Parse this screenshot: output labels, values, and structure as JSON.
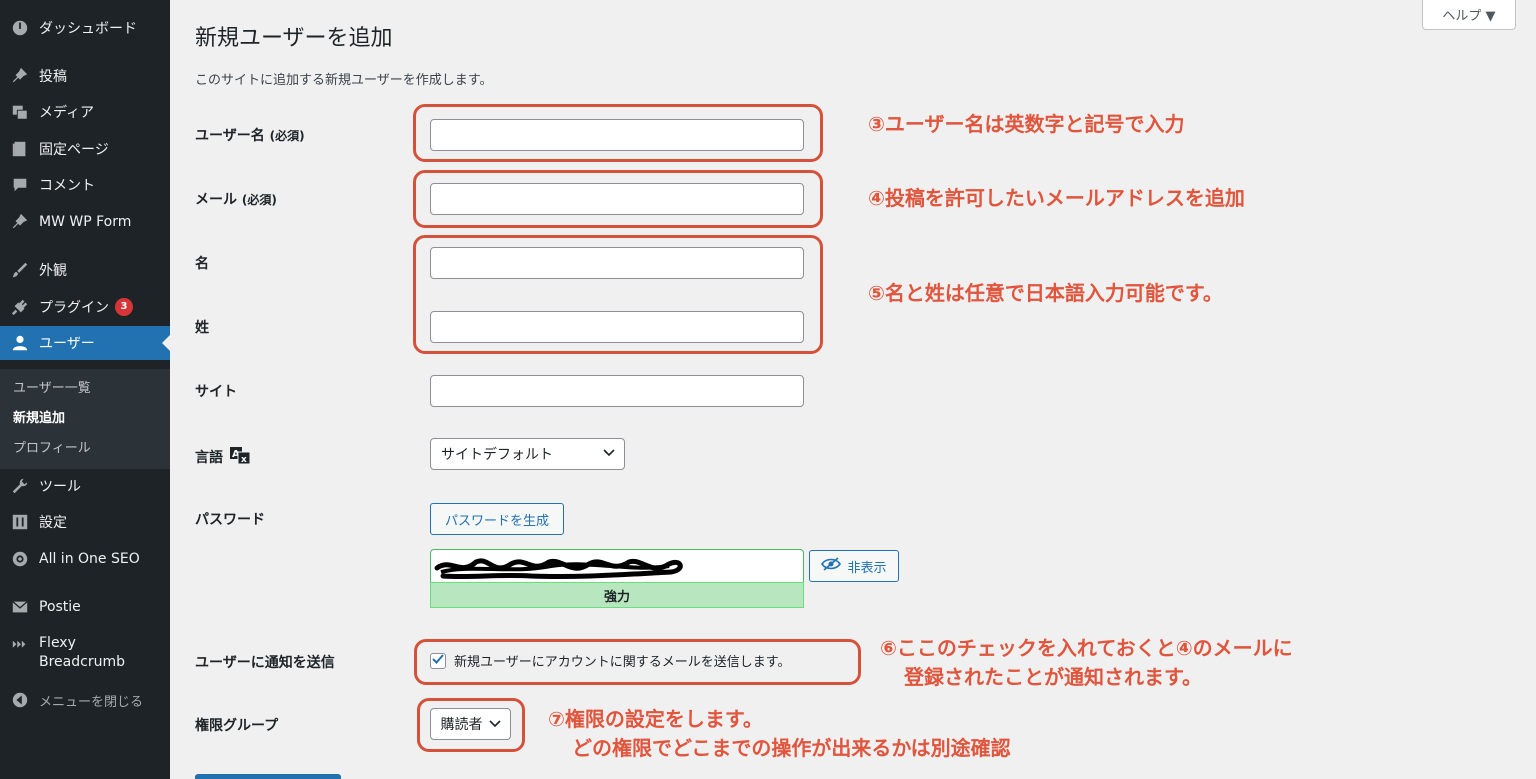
{
  "sidebar": {
    "items": [
      {
        "label": "ダッシュボード",
        "icon": "dashboard-icon"
      },
      {
        "label": "投稿",
        "icon": "pin-icon"
      },
      {
        "label": "メディア",
        "icon": "media-icon"
      },
      {
        "label": "固定ページ",
        "icon": "page-icon"
      },
      {
        "label": "コメント",
        "icon": "comment-icon"
      },
      {
        "label": "MW WP Form",
        "icon": "pin-icon"
      },
      {
        "label": "外観",
        "icon": "brush-icon"
      },
      {
        "label": "プラグイン",
        "icon": "plugin-icon",
        "badge": "3"
      },
      {
        "label": "ユーザー",
        "icon": "user-icon"
      },
      {
        "label": "ツール",
        "icon": "wrench-icon"
      },
      {
        "label": "設定",
        "icon": "settings-icon"
      },
      {
        "label": "All in One SEO",
        "icon": "seo-icon"
      },
      {
        "label": "Postie",
        "icon": "mail-icon"
      },
      {
        "label": "Flexy Breadcrumb",
        "line1": "Flexy",
        "line2": "Breadcrumb",
        "icon": "breadcrumb-icon"
      },
      {
        "label": "メニューを閉じる",
        "icon": "collapse-icon"
      }
    ],
    "submenu": [
      "ユーザー一覧",
      "新規追加",
      "プロフィール"
    ]
  },
  "header": {
    "title": "新規ユーザーを追加",
    "help": "ヘルプ ▼",
    "subtitle": "このサイトに追加する新規ユーザーを作成します。"
  },
  "form": {
    "username_label": "ユーザー名",
    "required": "(必須)",
    "email_label": "メール",
    "first_name_label": "名",
    "last_name_label": "姓",
    "site_label": "サイト",
    "language_label": "言語",
    "language_value": "サイトデフォルト",
    "password_label": "パスワード",
    "generate_password": "パスワードを生成",
    "password_strength": "強力",
    "hide_label": "非表示",
    "notify_label": "ユーザーに通知を送信",
    "notify_text": "新規ユーザーにアカウントに関するメールを送信します。",
    "notify_checked": true,
    "role_label": "権限グループ",
    "role_value": "購読者"
  },
  "annotations": {
    "a3": "③ユーザー名は英数字と記号で入力",
    "a4": "④投稿を許可したいメールアドレスを追加",
    "a5": "⑤名と姓は任意で日本語入力可能です。",
    "a6_line1": "⑥ここのチェックを入れておくと④のメールに",
    "a6_line2": "登録されたことが通知されます。",
    "a7_line1": "⑦権限の設定をします。",
    "a7_line2": "どの権限でどこまでの操作が出来るかは別途確認"
  },
  "colors": {
    "sidebar_bg": "#1d2327",
    "active_blue": "#2271b1",
    "annotation_red": "#e0553c",
    "page_bg": "#f0f0f1"
  }
}
